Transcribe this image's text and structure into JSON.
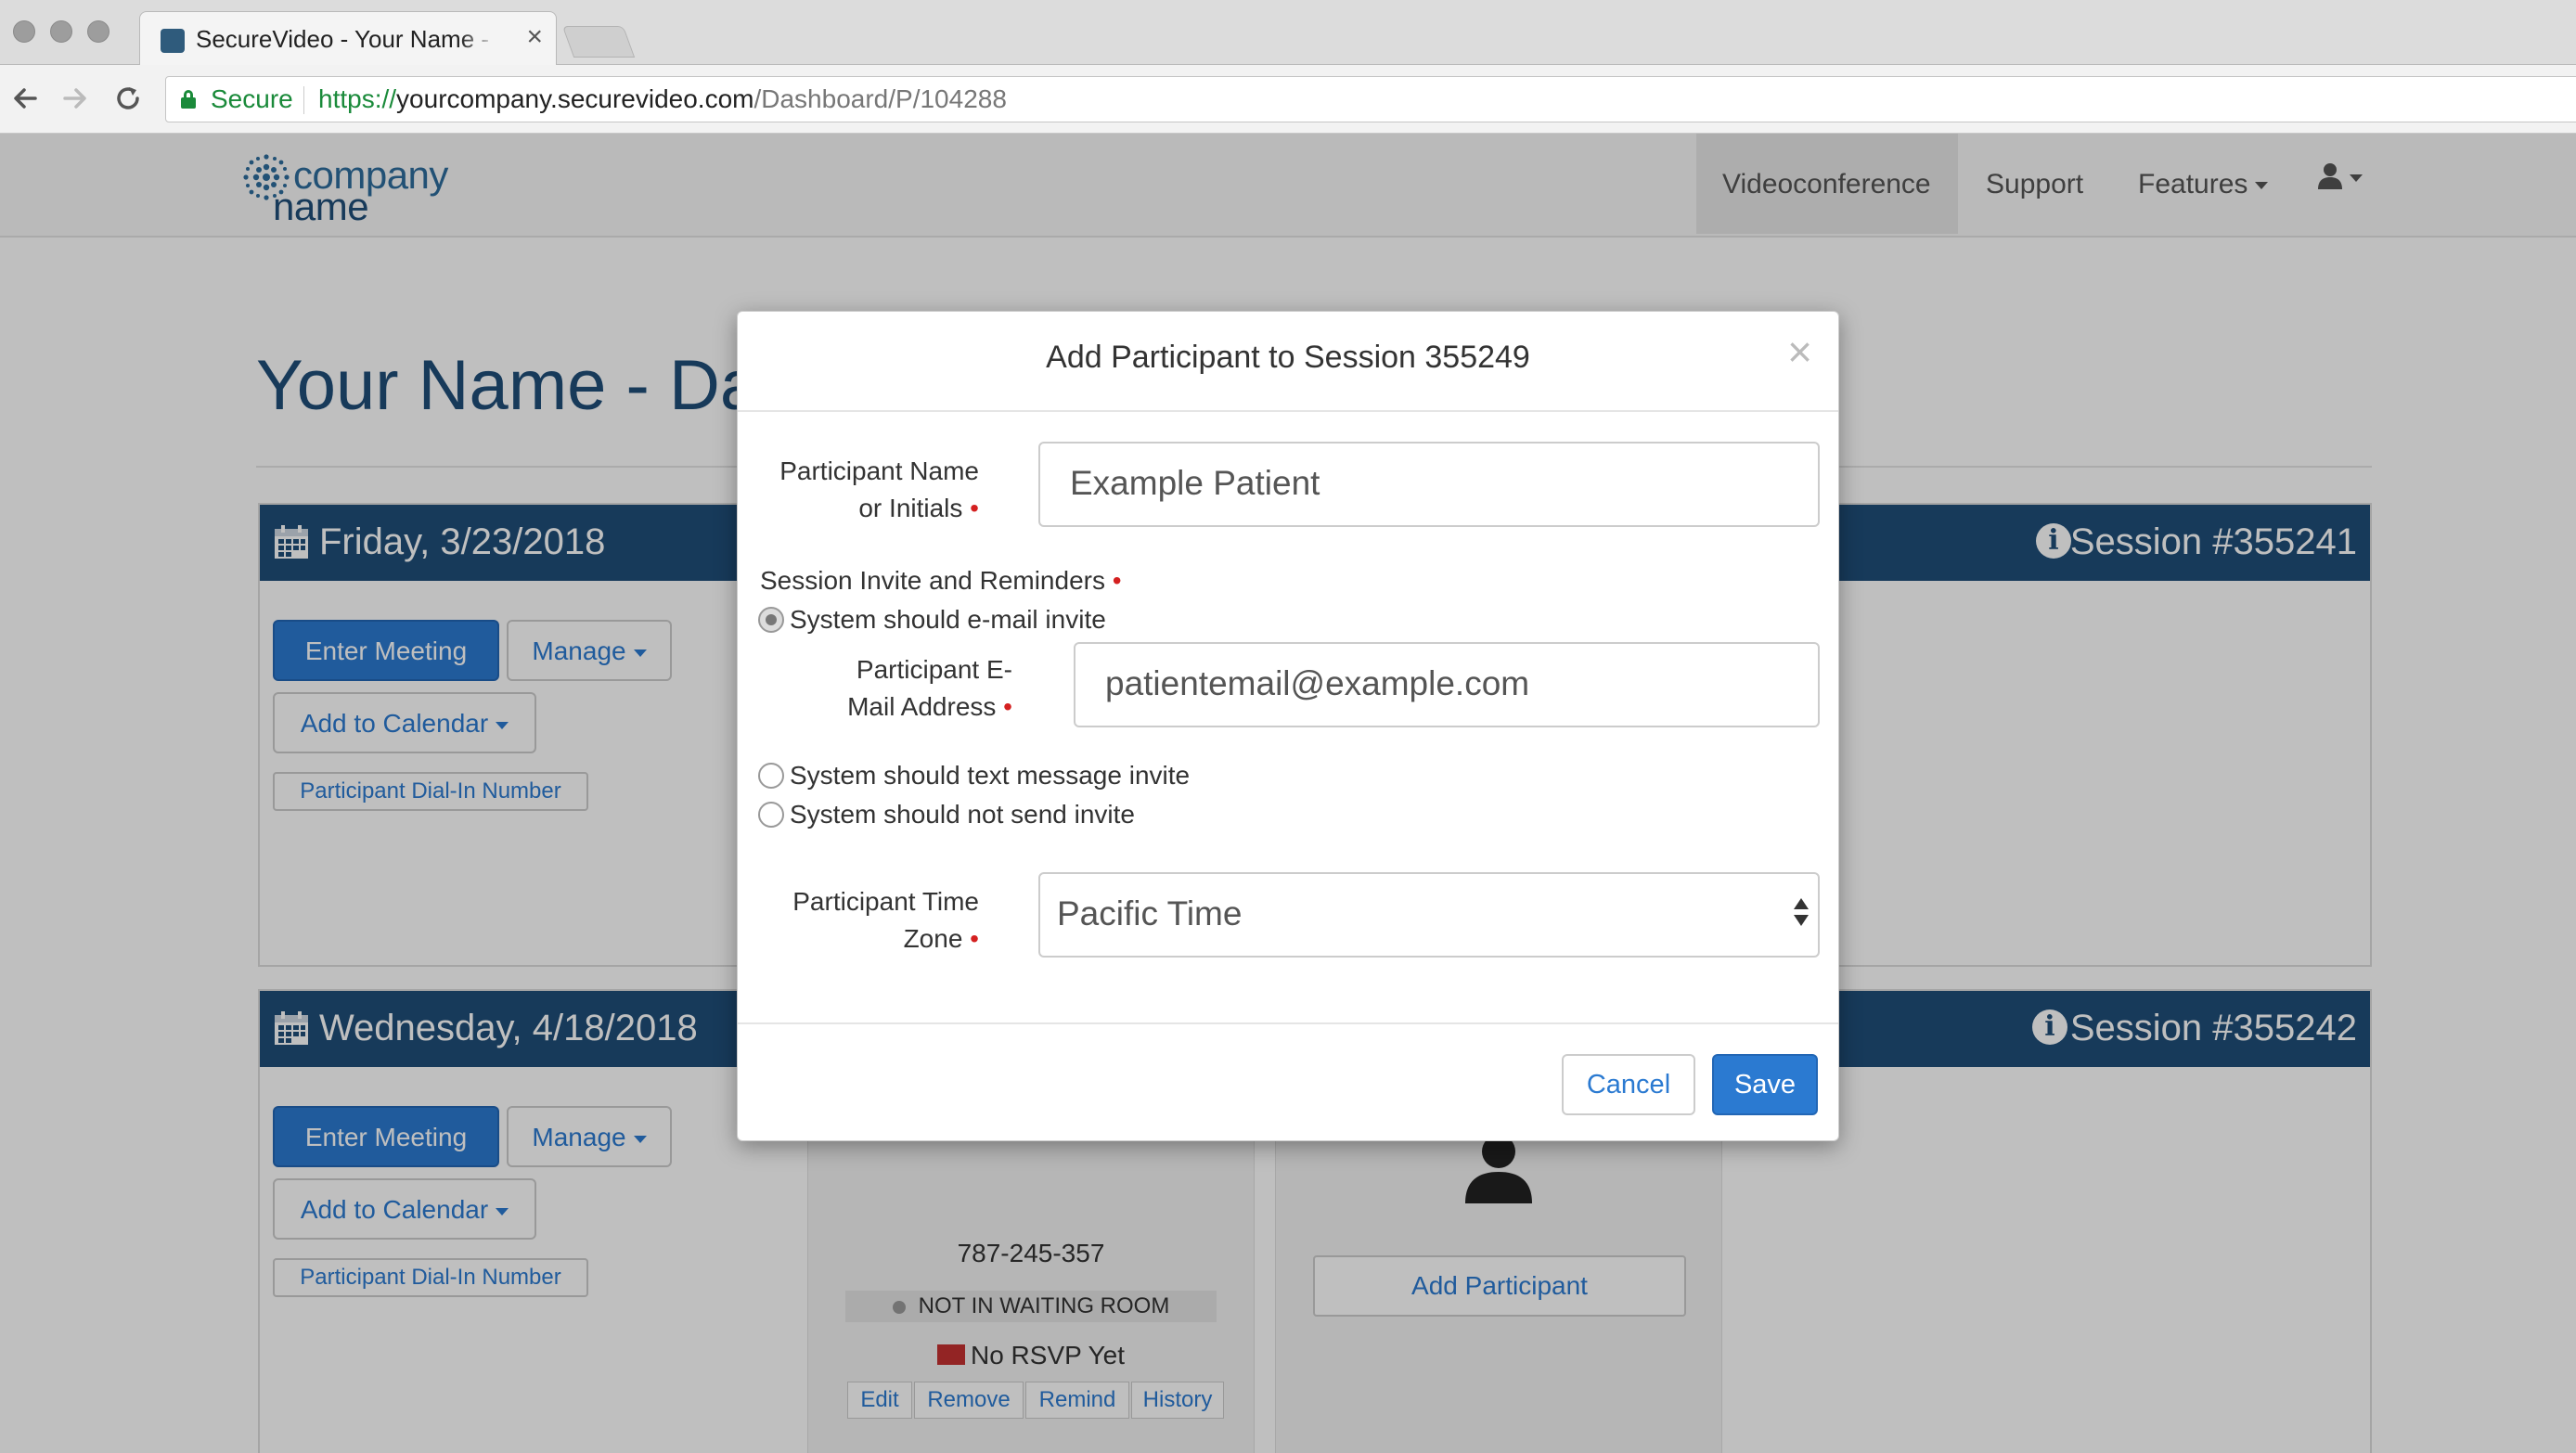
{
  "browser": {
    "tab_title": "SecureVideo - Your Name - Dashboard",
    "tab_close": "×",
    "secure_label": "Secure",
    "url_scheme": "https://",
    "url_host": "yourcompany.securevideo.com",
    "url_path": "/Dashboard/P/104288"
  },
  "site": {
    "logo_line1": "company",
    "logo_line2": "name",
    "nav": [
      {
        "label": "Videoconference"
      },
      {
        "label": "Support"
      },
      {
        "label": "Features"
      }
    ]
  },
  "page": {
    "title": "Your Name - Dashboard"
  },
  "sessions": [
    {
      "date": "Friday, 3/23/2018",
      "session": "Session #355241",
      "enter_meeting": "Enter Meeting",
      "manage": "Manage",
      "add_to_calendar": "Add to Calendar",
      "dial_in": "Participant Dial-In Number"
    },
    {
      "date": "Wednesday, 4/18/2018",
      "session": "Session #355242",
      "enter_meeting": "Enter Meeting",
      "manage": "Manage",
      "add_to_calendar": "Add to Calendar",
      "dial_in": "Participant Dial-In Number",
      "participant_card": {
        "phone": "787-245-357",
        "waiting_status": "NOT IN WAITING ROOM",
        "rsvp": "No RSVP Yet",
        "actions": [
          "Edit",
          "Remove",
          "Remind",
          "History"
        ]
      },
      "add_participant": "Add Participant"
    }
  ],
  "modal": {
    "title": "Add Participant to Session 355249",
    "close": "×",
    "name_label_1": "Participant Name",
    "name_label_2": "or Initials",
    "name_value": "Example Patient",
    "invite_label": "Session Invite and Reminders",
    "radio_email": "System should e-mail invite",
    "email_label_1": "Participant E-",
    "email_label_2": "Mail Address",
    "email_value": "patientemail@example.com",
    "radio_text": "System should text message invite",
    "radio_none": "System should not send invite",
    "tz_label_1": "Participant Time",
    "tz_label_2": "Zone",
    "tz_value": "Pacific Time",
    "cancel": "Cancel",
    "save": "Save"
  },
  "colors": {
    "brand_navy": "#1f4e79",
    "primary_blue": "#2b7ad1",
    "required_red": "#d42020"
  },
  "icons": [
    "back-arrow-icon",
    "forward-arrow-icon",
    "reload-icon",
    "lock-icon",
    "calendar-icon",
    "info-icon",
    "user-icon",
    "envelope-icon",
    "close-icon",
    "select-arrows-icon"
  ]
}
